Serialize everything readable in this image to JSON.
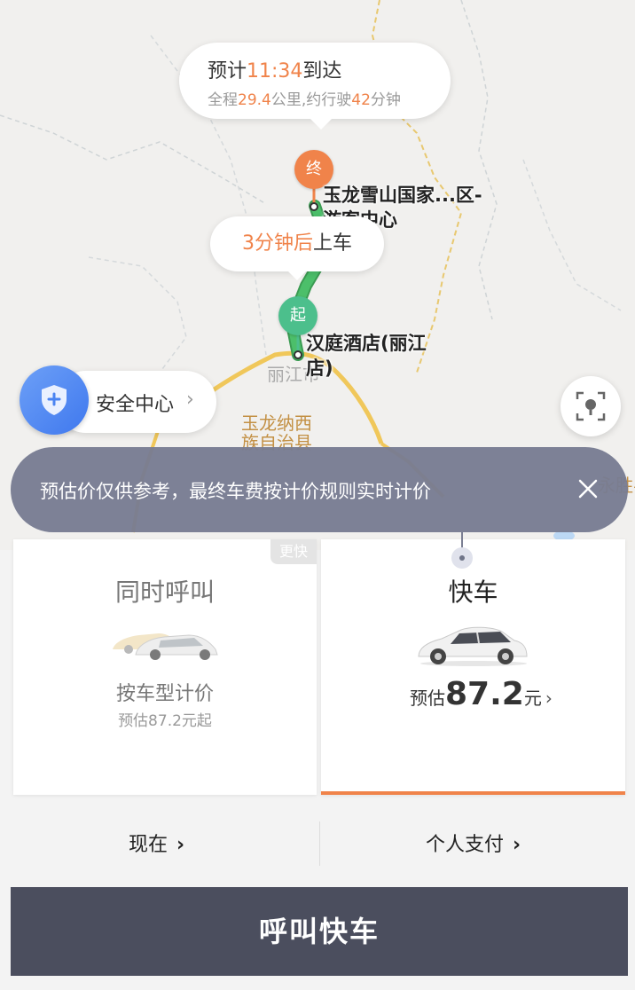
{
  "eta": {
    "prefix": "预计",
    "time": "11:34",
    "suffix": "到达",
    "dist_prefix": "全程",
    "distance": "29.4",
    "dist_mid": "公里,约行驶",
    "minutes": "42",
    "dist_suffix": "分钟"
  },
  "map": {
    "end_pin": "终",
    "start_pin": "起",
    "end_place": "玉龙雪山国家...区-游客中心",
    "start_place": "汉庭酒店(丽江店)",
    "city_label": "丽江市",
    "county_label": "玉龙纳西族自治县",
    "edge_label": "永胜县",
    "route_color": "#4cbf6a"
  },
  "pickup": {
    "highlight": "3分钟后",
    "text": "上车"
  },
  "safety": {
    "label": "安全中心",
    "chevron": "›"
  },
  "notice": {
    "text": "预估价仅供参考，最终车费按计价规则实时计价"
  },
  "cards": {
    "left": {
      "badge": "更快",
      "title": "同时呼叫",
      "subtitle": "按车型计价",
      "estimate": "预估87.2元起"
    },
    "right": {
      "title": "快车",
      "price_prefix": "预估",
      "price": "87.2",
      "price_unit": "元",
      "arrow": "›"
    }
  },
  "options": {
    "time_label": "现在",
    "payment_label": "个人支付",
    "arrow": "›"
  },
  "call_button": "呼叫快车",
  "colors": {
    "accent": "#f0834a",
    "start_green": "#4cbf8c",
    "button_bg": "#4b4e5e"
  }
}
